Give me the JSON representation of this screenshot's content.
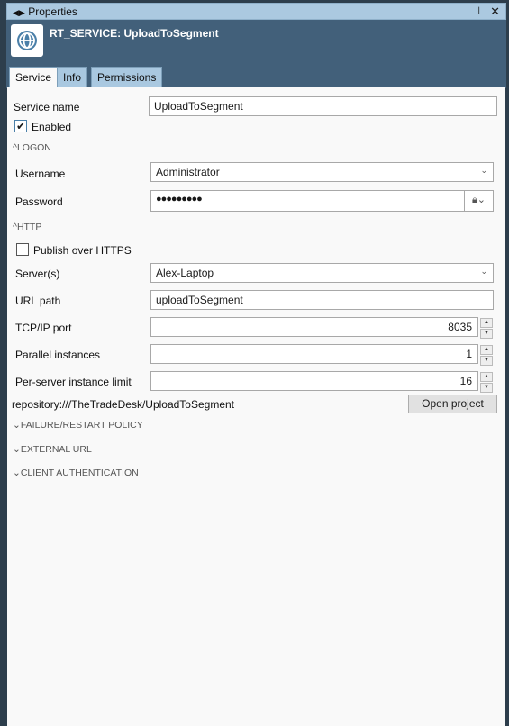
{
  "panel": {
    "title": "Properties",
    "nav_icons": "arrow-left-right-icon",
    "pin_icon": "pin-icon",
    "close_icon": "close-icon"
  },
  "header": {
    "title": "RT_SERVICE: UploadToSegment",
    "icon": "globe-icon"
  },
  "tabs": [
    {
      "label": "Service",
      "active": true
    },
    {
      "label": "Info",
      "active": false
    },
    {
      "label": "Permissions",
      "active": false
    }
  ],
  "form": {
    "service_name_label": "Service name",
    "service_name_value": "UploadToSegment",
    "enabled_label": "Enabled",
    "enabled_checked": true,
    "logon_section": "LOGON",
    "username_label": "Username",
    "username_value": "Administrator",
    "password_label": "Password",
    "password_value": "●●●●●●●●●",
    "http_section": "HTTP",
    "https_label": "Publish over HTTPS",
    "https_checked": false,
    "servers_label": "Server(s)",
    "servers_value": "Alex-Laptop",
    "url_label": "URL path",
    "url_value": "uploadToSegment",
    "port_label": "TCP/IP port",
    "port_value": "8035",
    "parallel_label": "Parallel instances",
    "parallel_value": "1",
    "limit_label": "Per-server instance limit",
    "limit_value": "16",
    "repository": "repository:///TheTradeDesk/UploadToSegment",
    "open_project": "Open project",
    "failure_section": "FAILURE/RESTART POLICY",
    "external_section": "EXTERNAL URL",
    "client_auth_section": "CLIENT AUTHENTICATION"
  }
}
